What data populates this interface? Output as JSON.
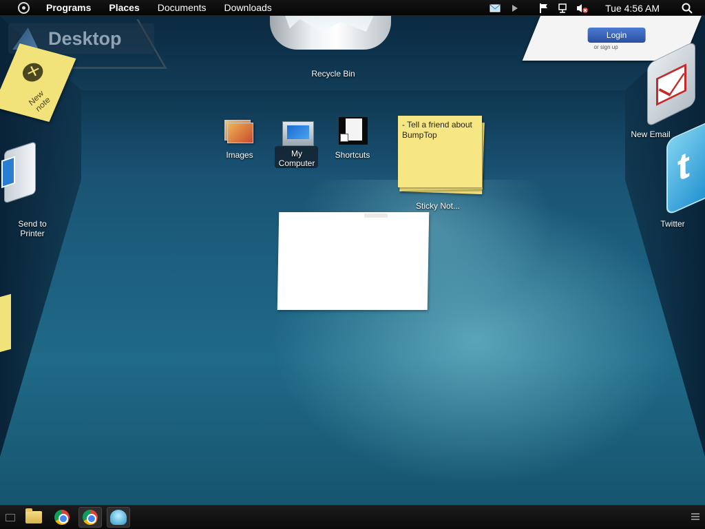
{
  "top_panel": {
    "menu_items": [
      "Programs",
      "Places",
      "Documents",
      "Downloads"
    ],
    "clock": "Tue 4:56 AM"
  },
  "desktop": {
    "title": "Desktop",
    "recycle_bin": "Recycle Bin",
    "new_note": "New note",
    "send_to_printer": "Send to\nPrinter",
    "login_button": "Login",
    "signup_text": "or sign up",
    "new_email": "New Email",
    "twitter": "Twitter",
    "images": "Images",
    "my_computer": "My\nComputer",
    "shortcuts": "Shortcuts",
    "sticky_note_text": "- Tell a friend about BumpTop",
    "sticky_notes_label": "Sticky Not..."
  },
  "taskbar": {
    "icons": [
      "terminal-icon",
      "file-manager-icon",
      "chrome-icon",
      "chrome-icon",
      "bumptop-icon"
    ]
  },
  "colors": {
    "floor": "#1f6a88",
    "panel": "#0a0a0a",
    "sticky": "#f4e27a"
  }
}
